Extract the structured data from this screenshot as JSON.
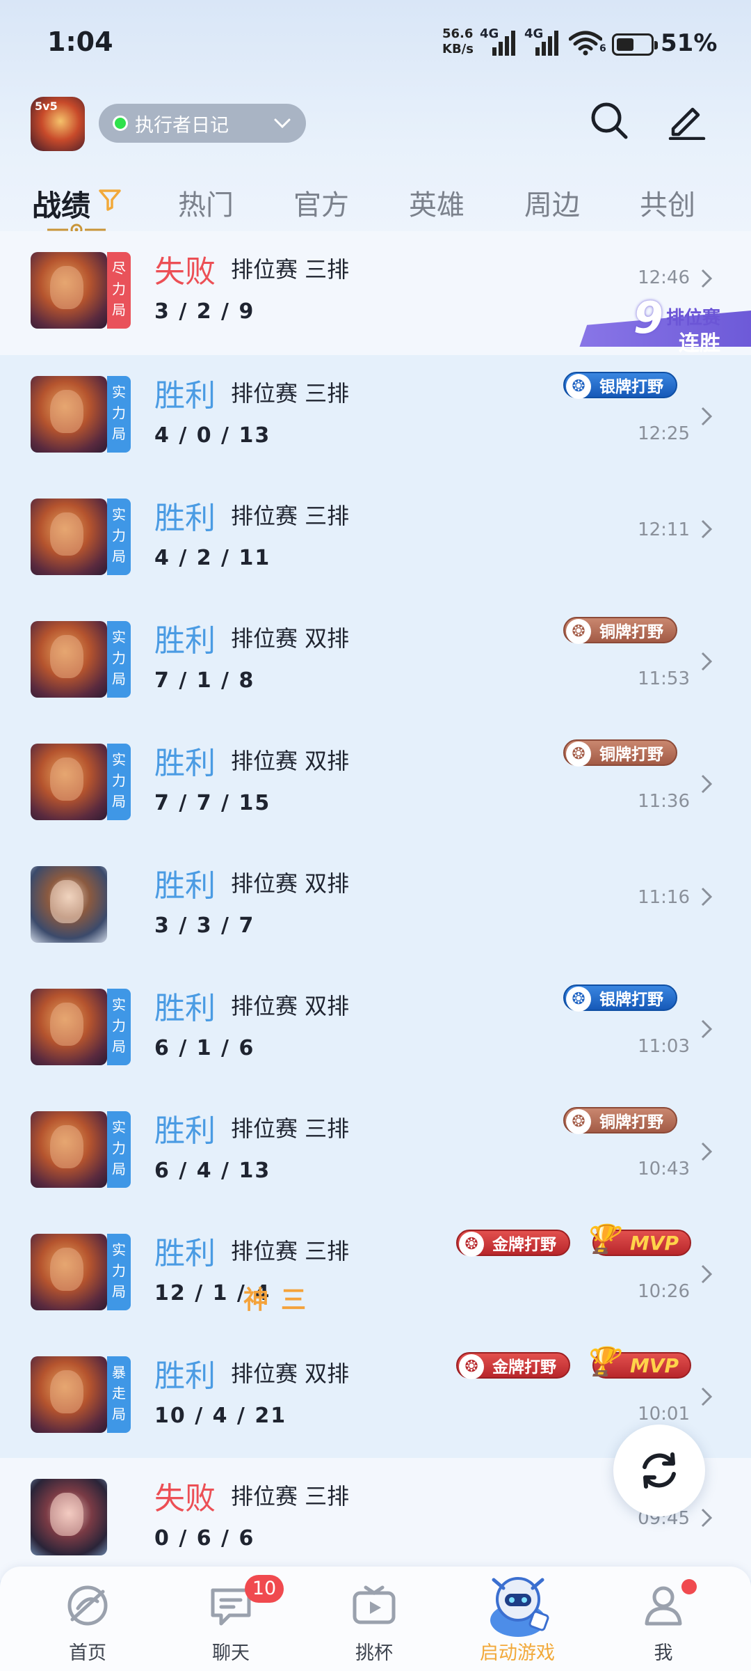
{
  "status_bar": {
    "time": "1:04",
    "net_speed_value": "56.6",
    "net_speed_unit": "KB/s",
    "net_type_1": "4G",
    "net_type_2": "4G",
    "wifi_sub": "6",
    "battery_percent": "51%"
  },
  "header": {
    "diary_label": "执行者日记",
    "app_logo_text": "5v5"
  },
  "tabs": [
    {
      "label": "战绩",
      "active": true
    },
    {
      "label": "热门"
    },
    {
      "label": "官方"
    },
    {
      "label": "英雄"
    },
    {
      "label": "周边"
    },
    {
      "label": "共创"
    }
  ],
  "streak": {
    "number": "9",
    "line1": "排位赛",
    "line2": "连胜"
  },
  "matches": [
    {
      "result": "失败",
      "type": "排位赛 三排",
      "kda": "3 / 2 / 9",
      "time": "12:46",
      "tag": [
        "尽",
        "力",
        "局"
      ],
      "tag_color": "red"
    },
    {
      "result": "胜利",
      "type": "排位赛 三排",
      "kda": "4 / 0 / 13",
      "time": "12:25",
      "tag": [
        "实",
        "力",
        "局"
      ],
      "tag_color": "blue",
      "badge": "银牌打野"
    },
    {
      "result": "胜利",
      "type": "排位赛 三排",
      "kda": "4 / 2 / 11",
      "time": "12:11",
      "tag": [
        "实",
        "力",
        "局"
      ],
      "tag_color": "blue"
    },
    {
      "result": "胜利",
      "type": "排位赛 双排",
      "kda": "7 / 1 / 8",
      "time": "11:53",
      "tag": [
        "实",
        "力",
        "局"
      ],
      "tag_color": "blue",
      "badge": "铜牌打野"
    },
    {
      "result": "胜利",
      "type": "排位赛 双排",
      "kda": "7 / 7 / 15",
      "time": "11:36",
      "tag": [
        "实",
        "力",
        "局"
      ],
      "tag_color": "blue",
      "badge": "铜牌打野"
    },
    {
      "result": "胜利",
      "type": "排位赛 双排",
      "kda": "3 / 3 / 7",
      "time": "11:16"
    },
    {
      "result": "胜利",
      "type": "排位赛 双排",
      "kda": "6 / 1 / 6",
      "time": "11:03",
      "tag": [
        "实",
        "力",
        "局"
      ],
      "tag_color": "blue",
      "badge": "银牌打野"
    },
    {
      "result": "胜利",
      "type": "排位赛 三排",
      "kda": "6 / 4 / 13",
      "time": "10:43",
      "tag": [
        "实",
        "力",
        "局"
      ],
      "tag_color": "blue",
      "badge": "铜牌打野"
    },
    {
      "result": "胜利",
      "type": "排位赛 三排",
      "kda": "12 / 1 / 4",
      "kda_extra": [
        "神",
        "三"
      ],
      "time": "10:26",
      "tag": [
        "实",
        "力",
        "局"
      ],
      "tag_color": "blue",
      "badge": "金牌打野",
      "mvp": "MVP"
    },
    {
      "result": "胜利",
      "type": "排位赛 双排",
      "kda": "10 / 4 / 21",
      "time": "10:01",
      "tag": [
        "暴",
        "走",
        "局"
      ],
      "tag_color": "blue",
      "badge": "金牌打野",
      "mvp": "MVP"
    },
    {
      "result": "失败",
      "type": "排位赛 三排",
      "kda": "0 / 6 / 6",
      "time": "09:45"
    }
  ],
  "bottom_nav": [
    {
      "label": "首页"
    },
    {
      "label": "聊天",
      "badge": "10"
    },
    {
      "label": "挑杯"
    },
    {
      "label": "启动游戏",
      "active": true
    },
    {
      "label": "我"
    }
  ],
  "colors": {
    "win": "#4a9be3",
    "lose": "#ec4f55",
    "active_nav": "#f2a93a",
    "streak": "#6d5ad8"
  }
}
